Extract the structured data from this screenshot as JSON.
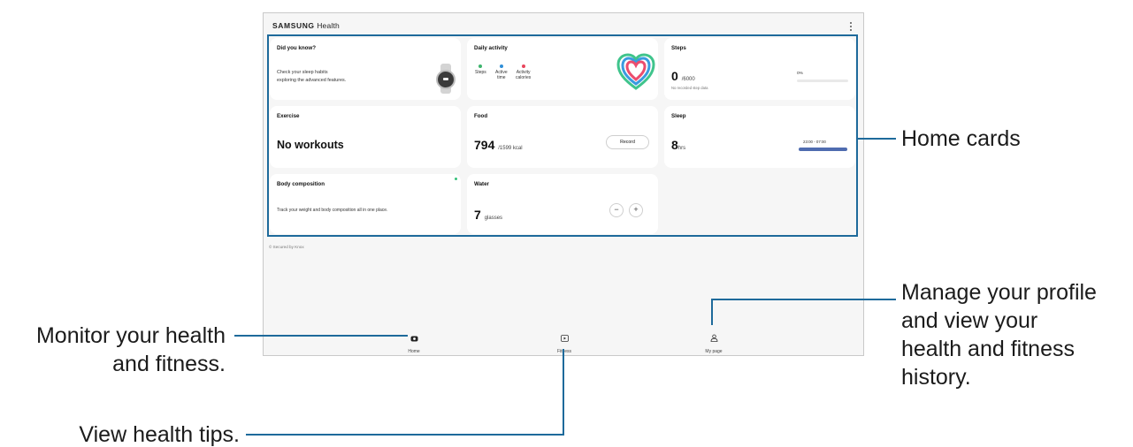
{
  "app": {
    "brand_bold": "SAMSUNG",
    "brand_light": "Health",
    "menu_icon": "more-vertical-icon"
  },
  "cards": {
    "did_you_know": {
      "title": "Did you know?",
      "line1": "Check your sleep habits",
      "line2": "exploring the advanced features."
    },
    "daily_activity": {
      "title": "Daily activity",
      "items": [
        {
          "line1": "Steps",
          "line2": "",
          "color": "#3db46d"
        },
        {
          "line1": "Active",
          "line2": "time",
          "color": "#2f8fd8"
        },
        {
          "line1": "Activity",
          "line2": "calories",
          "color": "#e8455c"
        }
      ]
    },
    "steps": {
      "title": "Steps",
      "value": "0",
      "goal": "/6000",
      "note": "No recorded step data",
      "percent": "0%",
      "progress": 0
    },
    "exercise": {
      "title": "Exercise",
      "value": "No workouts"
    },
    "food": {
      "title": "Food",
      "value": "794",
      "unit": "/1599 kcal",
      "button": "Record"
    },
    "sleep": {
      "title": "Sleep",
      "value": "8",
      "unit": "hrs",
      "range": "23:00 - 07:00"
    },
    "body_composition": {
      "title": "Body composition",
      "text": "Track your weight and body composition all in one place."
    },
    "water": {
      "title": "Water",
      "value": "7",
      "unit": "glasses",
      "minus": "−",
      "plus": "+"
    }
  },
  "footer_note": "© Secured by Knox",
  "nav": {
    "home": "Home",
    "fitness": "Fitness",
    "my_page": "My page"
  },
  "callouts": {
    "home_cards": "Home cards",
    "profile": [
      "Manage your profile",
      "and view your",
      "health and fitness",
      "history."
    ],
    "monitor": [
      "Monitor your health",
      "and fitness."
    ],
    "tips": "View health tips."
  },
  "colors": {
    "annotation": "#1e6a9b",
    "sleep_bar": "#4f6cb0",
    "notification_dot": "#36c07a"
  }
}
